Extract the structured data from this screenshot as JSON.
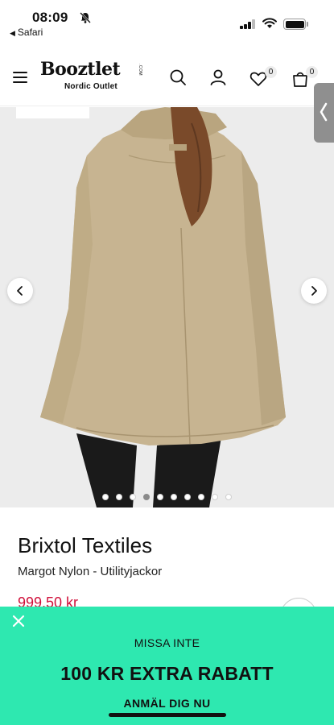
{
  "status_bar": {
    "time": "08:09",
    "back_app": "Safari"
  },
  "header": {
    "logo_text": "Booztlet",
    "logo_com": ".COM",
    "logo_subtitle": "Nordic Outlet",
    "wishlist_count": "0",
    "cart_count": "0"
  },
  "gallery": {
    "image_count": 10,
    "active_index": 3
  },
  "product": {
    "brand": "Brixtol Textiles",
    "name": "Margot Nylon - Utilityjackor",
    "price": "999,50 kr"
  },
  "promo": {
    "kicker": "MISSA INTE",
    "title": "100 KR EXTRA RABATT",
    "cta": "ANMÄL DIG NU"
  },
  "colors": {
    "accent_green": "#2ee8b0",
    "price_red": "#d0103a"
  }
}
